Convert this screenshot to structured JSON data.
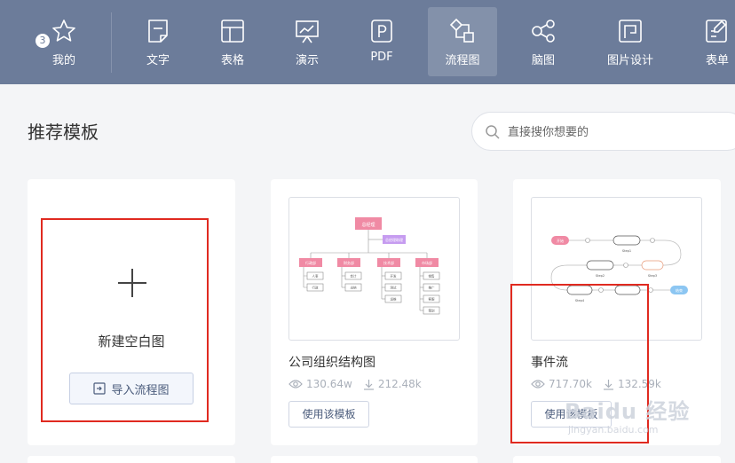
{
  "nav": {
    "items": [
      {
        "label": "我的",
        "icon": "star-icon"
      },
      {
        "label": "文字",
        "icon": "document-icon"
      },
      {
        "label": "表格",
        "icon": "table-icon"
      },
      {
        "label": "演示",
        "icon": "presentation-icon"
      },
      {
        "label": "PDF",
        "icon": "pdf-icon"
      },
      {
        "label": "流程图",
        "icon": "flowchart-icon"
      },
      {
        "label": "脑图",
        "icon": "mindmap-icon"
      },
      {
        "label": "图片设计",
        "icon": "image-design-icon"
      },
      {
        "label": "表单",
        "icon": "form-icon"
      }
    ],
    "active": "流程图",
    "my_badge": "3"
  },
  "section": {
    "title": "推荐模板"
  },
  "search": {
    "placeholder": "直接搜你想要的"
  },
  "blank_card": {
    "label": "新建空白图",
    "import_label": "导入流程图"
  },
  "templates": [
    {
      "title": "公司组织结构图",
      "views": "130.64w",
      "downloads": "212.48k",
      "button": "使用该模板"
    },
    {
      "title": "事件流",
      "views": "717.70k",
      "downloads": "132.59k",
      "button": "使用该模板"
    }
  ],
  "thumb_org": {
    "root": "总经理",
    "assistant": "总经理助理",
    "departments": [
      "行政部",
      "财务部",
      "技术部",
      "市场部"
    ],
    "staff": [
      [
        "人事",
        "行政"
      ],
      [
        "会计",
        "出纳"
      ],
      [
        "开发",
        "测试",
        "运维"
      ],
      [
        "销售",
        "推广",
        "客服",
        "策划"
      ]
    ]
  },
  "thumb_event": {
    "start": "开始",
    "steps": [
      "Step1",
      "Step2",
      "Step3",
      "Step4"
    ],
    "end": "结束"
  },
  "watermark": {
    "text": "Baidu 经验",
    "sub": "jingyan.baidu.com"
  },
  "colors": {
    "nav_bg": "#6c7c9a",
    "page_bg": "#f4f5f7",
    "highlight": "#e02a20",
    "accent": "#4a5b7b"
  }
}
